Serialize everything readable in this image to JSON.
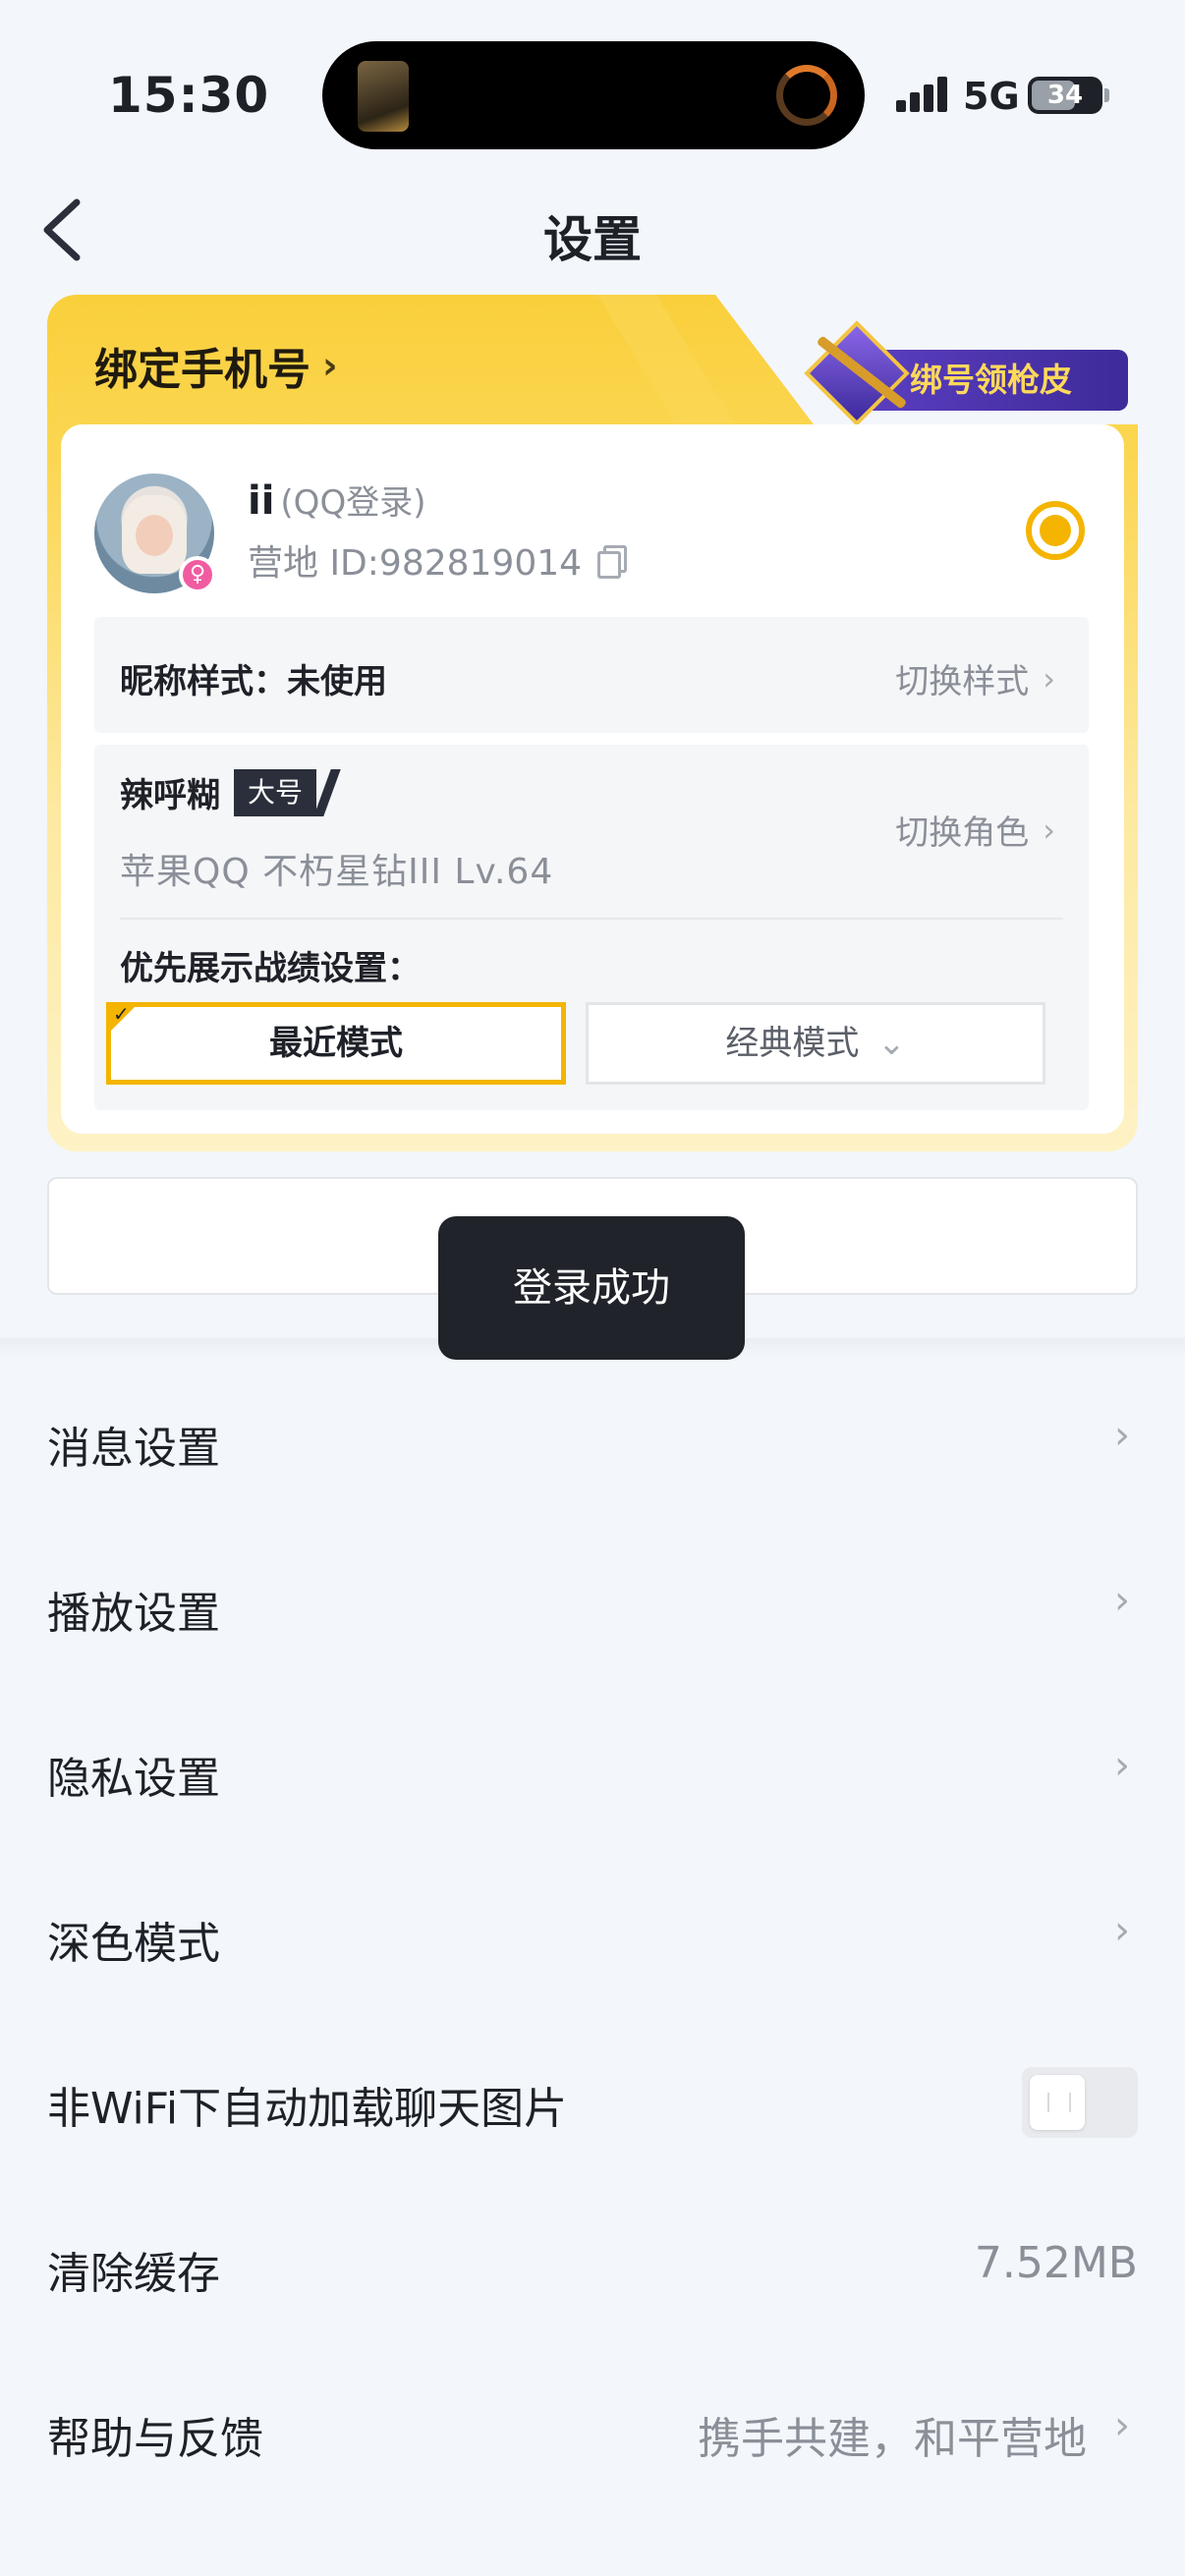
{
  "status_bar": {
    "time": "15:30",
    "network": "5G",
    "battery": "34"
  },
  "nav": {
    "title": "设置"
  },
  "account": {
    "bind_phone": "绑定手机号",
    "reward": "绑号领枪皮",
    "nickname": "ii",
    "login_type": "(QQ登录)",
    "camp_id": "营地 ID:982819014",
    "nick_style_label": "昵称样式：未使用",
    "nick_style_action": "切换样式",
    "role_name": "辣呼糊",
    "role_tag": "大号",
    "role_info": "苹果QQ  不朽星钻III  Lv.64",
    "switch_role": "切换角色",
    "pref_label": "优先展示战绩设置：",
    "mode_recent": "最近模式",
    "mode_classic": "经典模式"
  },
  "toast": "登录成功",
  "settings": [
    {
      "label": "消息设置"
    },
    {
      "label": "播放设置"
    },
    {
      "label": "隐私设置"
    },
    {
      "label": "深色模式"
    },
    {
      "label": "非WiFi下自动加载聊天图片",
      "toggle": false
    },
    {
      "label": "清除缓存",
      "value": "7.52MB"
    },
    {
      "label": "帮助与反馈",
      "value": "携手共建，和平营地"
    }
  ],
  "colors": {
    "accent": "#f4b400",
    "toast_bg": "#202329",
    "page_bg": "#f3f6fb"
  }
}
